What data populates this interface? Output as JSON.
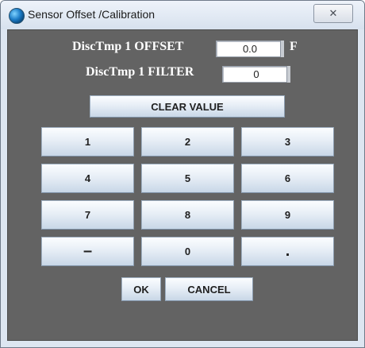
{
  "window": {
    "title": "Sensor Offset /Calibration",
    "close_glyph": "✕"
  },
  "fields": {
    "offset": {
      "label": "DiscTmp 1 OFFSET",
      "value": "0.0",
      "unit": "F"
    },
    "filter": {
      "label": "DiscTmp 1 FILTER",
      "value": "0"
    }
  },
  "buttons": {
    "clear": "CLEAR VALUE",
    "keys": [
      "1",
      "2",
      "3",
      "4",
      "5",
      "6",
      "7",
      "8",
      "9",
      "–",
      "0",
      "."
    ],
    "ok": "OK",
    "cancel": "CANCEL"
  },
  "colors": {
    "panel": "#636363",
    "label_text": "#ffffff",
    "button_top": "#fbfdff",
    "button_bottom": "#c8d7e7"
  }
}
